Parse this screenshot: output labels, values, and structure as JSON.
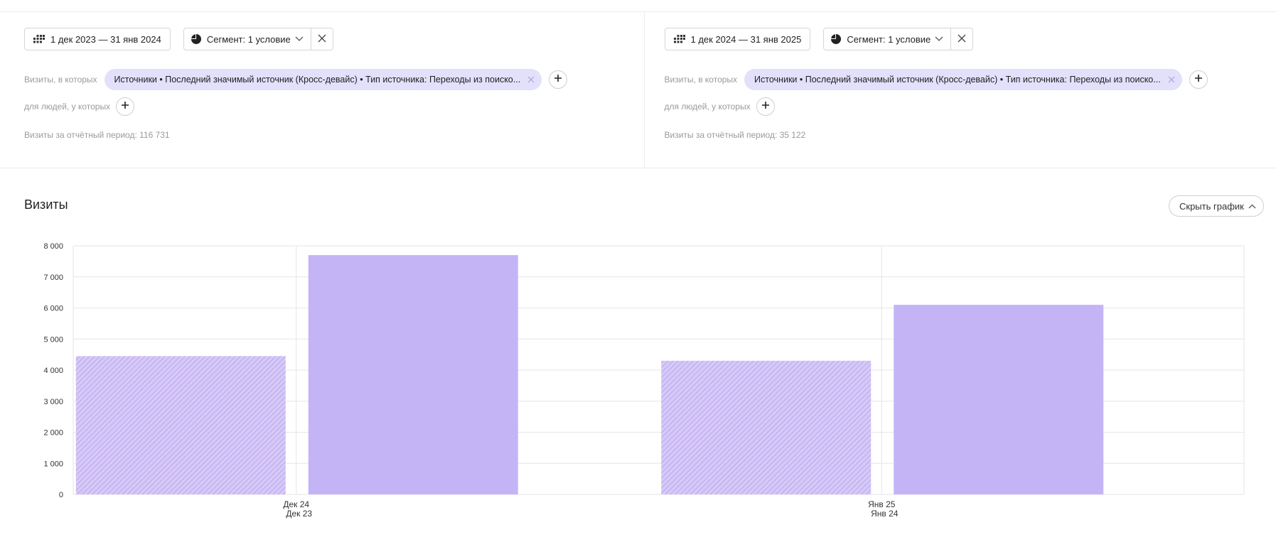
{
  "left_panel": {
    "date_range": "1 дек 2023 — 31 янв 2024",
    "segment_label": "Сегмент: 1 условие",
    "visits_where": "Визиты, в которых",
    "condition": "Источники • Последний значимый источник (Кросс-девайс) • Тип источника: Переходы из поиско...",
    "people_where": "для людей, у которых",
    "period_visits": "Визиты за отчётный период: 116 731"
  },
  "right_panel": {
    "date_range": "1 дек 2024 — 31 янв 2025",
    "segment_label": "Сегмент: 1 условие",
    "visits_where": "Визиты, в которых",
    "condition": "Источники • Последний значимый источник (Кросс-девайс) • Тип источника: Переходы из поиско...",
    "people_where": "для людей, у которых",
    "period_visits": "Визиты за отчётный период: 35 122"
  },
  "section": {
    "title": "Визиты",
    "hide_chart": "Скрыть график"
  },
  "colors": {
    "bar": "#c4b4f6",
    "bar_hatched": "#d6c9f7",
    "hatch_line": "#b9a6ef",
    "chip_bg": "#e3e0fb",
    "grid": "#e6e6e6"
  },
  "icons": {
    "date": "calendar-grid-icon",
    "segment": "pie-segment-icon",
    "dropdown": "chevron-down-icon",
    "close": "close-icon",
    "add": "plus-icon",
    "collapse": "chevron-up-icon"
  },
  "chart_data": {
    "type": "bar",
    "categories": [
      {
        "label_top": "Дек 24",
        "label_bottom": "Дек 23"
      },
      {
        "label_top": "Янв 25",
        "label_bottom": "Янв 24"
      }
    ],
    "series": [
      {
        "style": "hatched",
        "values": [
          4450,
          4300
        ]
      },
      {
        "style": "solid",
        "values": [
          7700,
          6100
        ]
      }
    ],
    "yticks": [
      0,
      1000,
      2000,
      3000,
      4000,
      5000,
      6000,
      7000,
      8000
    ],
    "ytick_labels": [
      "0",
      "1 000",
      "2 000",
      "3 000",
      "4 000",
      "5 000",
      "6 000",
      "7 000",
      "8 000"
    ],
    "ylim": [
      0,
      8000
    ],
    "grid": true
  }
}
